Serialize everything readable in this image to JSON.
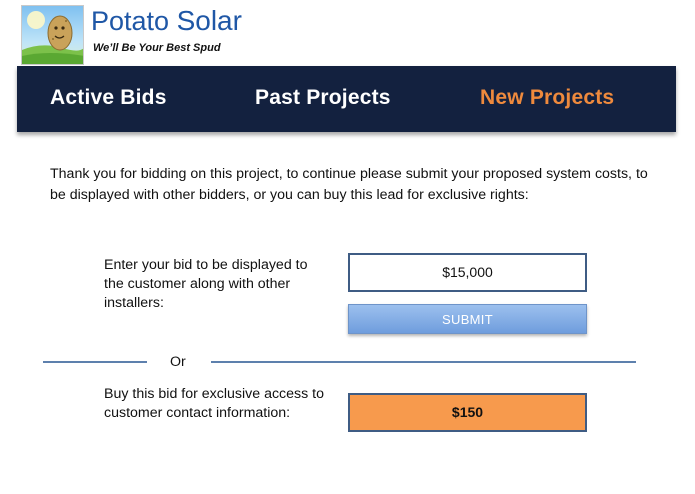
{
  "brand": {
    "name_first": "Potato",
    "name_second": "Solar",
    "tagline": "We’ll Be Your Best Spud",
    "logo_icon": "potato-mascot-icon"
  },
  "nav": {
    "items": [
      {
        "label": "Active Bids"
      },
      {
        "label": "Past Projects"
      },
      {
        "label": "New Projects",
        "active": true
      }
    ],
    "active_color": "#ef8a3d",
    "background_color": "#13213f"
  },
  "intro": "Thank you for bidding on this project, to continue please submit your proposed system costs, to be displayed with other bidders, or you can buy this lead for exclusive rights:",
  "bid": {
    "label": "Enter your bid to be displayed to the customer along with other installers:",
    "value": "$15,000",
    "submit_label": "SUBMIT"
  },
  "or_label": "Or",
  "buy": {
    "label": "Buy this bid for exclusive access to customer contact information:",
    "price_label": "$150",
    "button_color": "#f79a4d"
  }
}
